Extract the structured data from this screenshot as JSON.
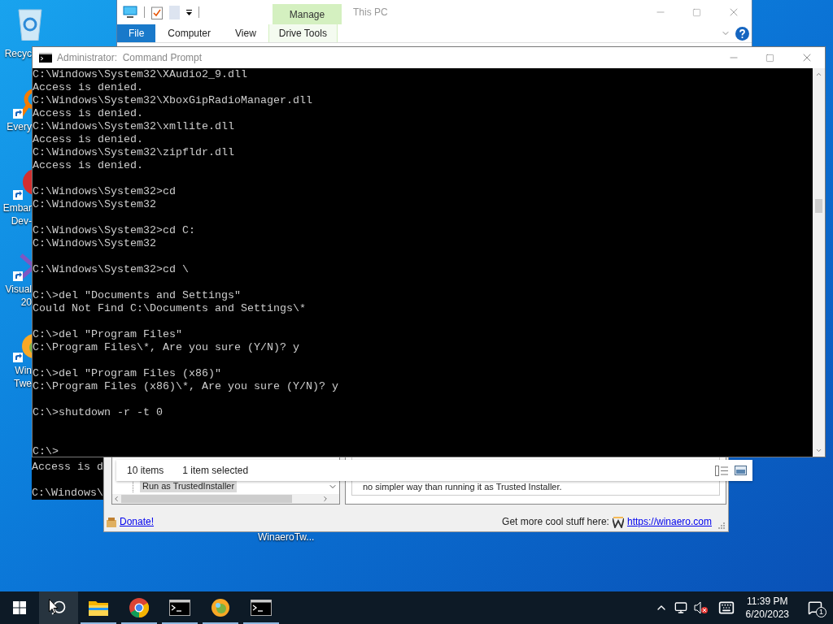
{
  "desktop": {
    "icons": [
      {
        "kind": "recycle-bin",
        "label": [
          "Recyc"
        ]
      },
      {
        "kind": "search-app",
        "label": [
          "Every"
        ]
      },
      {
        "kind": "ide-red",
        "label": [
          "Embar",
          "Dev-"
        ]
      },
      {
        "kind": "ide-purple",
        "label": [
          "Visual",
          "20"
        ]
      },
      {
        "kind": "tweaker",
        "label": [
          "Win",
          "Twe"
        ]
      }
    ],
    "bottom_label": "WinaeroTw..."
  },
  "explorer": {
    "title": "This PC",
    "tabs": [
      {
        "label": "File",
        "selected": true,
        "kind": "normal"
      },
      {
        "label": "Computer",
        "selected": false,
        "kind": "normal"
      },
      {
        "label": "View",
        "selected": false,
        "kind": "normal"
      },
      {
        "label": "Drive Tools",
        "selected": false,
        "kind": "contextual",
        "group": "Manage"
      }
    ],
    "status": [
      "10 items",
      "1 item selected"
    ]
  },
  "console": {
    "title": "Administrator:  Command Prompt",
    "lines": [
      {
        "kind": "text",
        "text": "C:\\Windows\\System32\\XAudio2_9.dll"
      },
      {
        "kind": "text",
        "text": "Access is denied."
      },
      {
        "kind": "text",
        "text": "C:\\Windows\\System32\\XboxGipRadioManager.dll"
      },
      {
        "kind": "text",
        "text": "Access is denied."
      },
      {
        "kind": "text",
        "text": "C:\\Windows\\System32\\xmllite.dll"
      },
      {
        "kind": "text",
        "text": "Access is denied."
      },
      {
        "kind": "text",
        "text": "C:\\Windows\\System32\\zipfldr.dll"
      },
      {
        "kind": "text",
        "text": "Access is denied."
      },
      {
        "kind": "blank"
      },
      {
        "kind": "text",
        "text": "C:\\Windows\\System32>cd"
      },
      {
        "kind": "text",
        "text": "C:\\Windows\\System32"
      },
      {
        "kind": "blank"
      },
      {
        "kind": "text",
        "text": "C:\\Windows\\System32>cd C:"
      },
      {
        "kind": "text",
        "text": "C:\\Windows\\System32"
      },
      {
        "kind": "blank"
      },
      {
        "kind": "text",
        "text": "C:\\Windows\\System32>cd \\"
      },
      {
        "kind": "blank"
      },
      {
        "kind": "text",
        "text": "C:\\>del \"Documents and Settings\""
      },
      {
        "kind": "text",
        "text": "Could Not Find C:\\Documents and Settings\\*"
      },
      {
        "kind": "blank"
      },
      {
        "kind": "text",
        "text": "C:\\>del \"Program Files\""
      },
      {
        "kind": "text",
        "text": "C:\\Program Files\\*, Are you sure (Y/N)? y"
      },
      {
        "kind": "blank"
      },
      {
        "kind": "text",
        "text": "C:\\>del \"Program Files (x86)\""
      },
      {
        "kind": "text",
        "text": "C:\\Program Files (x86)\\*, Are you sure (Y/N)? y"
      },
      {
        "kind": "blank"
      },
      {
        "kind": "text",
        "text": "C:\\>shutdown -r -t 0"
      },
      {
        "kind": "blank"
      },
      {
        "kind": "blank"
      },
      {
        "kind": "text",
        "text": "C:\\>"
      }
    ],
    "fragment": [
      {
        "kind": "text",
        "text": "Access is d"
      },
      {
        "kind": "blank"
      },
      {
        "kind": "text",
        "text": "C:\\Windows\\"
      }
    ]
  },
  "tweaker": {
    "tree_item": "Run as TrustedInstaller",
    "description": "no simpler way than running it as Trusted Installer.",
    "donate": "Donate!",
    "promo": "Get more cool stuff here:",
    "link": "https://winaero.com"
  },
  "taskbar": {
    "search_highlighted": true,
    "apps": [
      {
        "kind": "folder",
        "running": true
      },
      {
        "kind": "browser",
        "running": true
      },
      {
        "kind": "terminal",
        "running": true
      },
      {
        "kind": "tweaker",
        "running": true
      },
      {
        "kind": "terminal",
        "running": true
      }
    ],
    "volume_muted": true,
    "time": "11:39 PM",
    "date": "6/20/2023",
    "notifications": "1"
  }
}
